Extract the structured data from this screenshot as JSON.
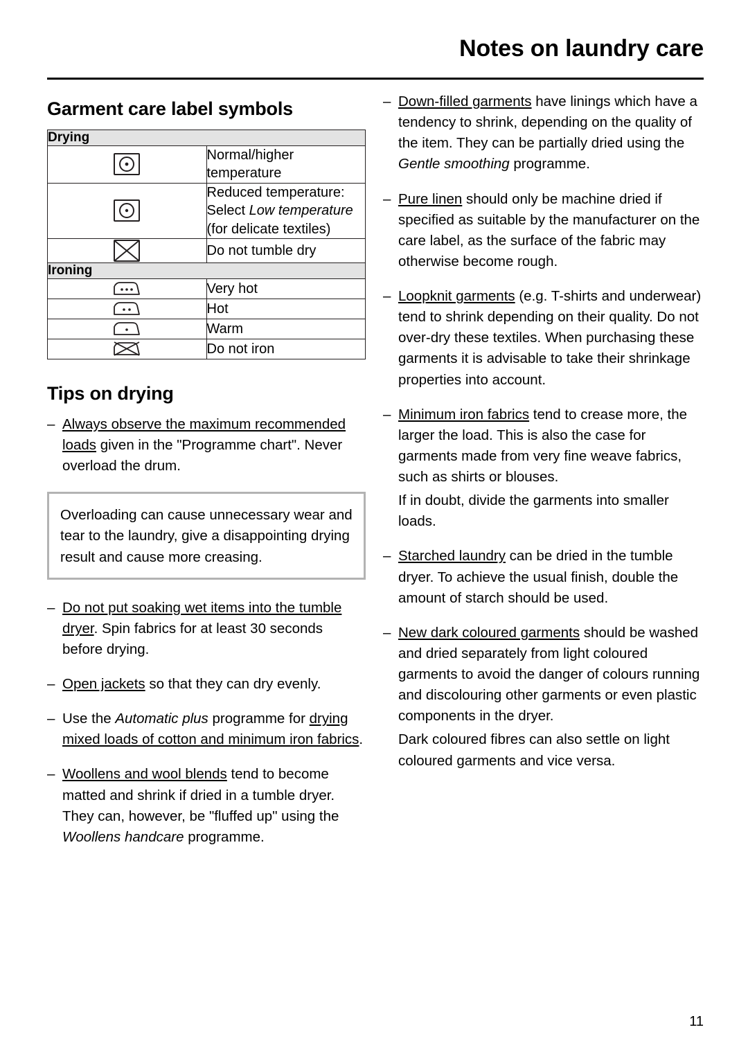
{
  "header": {
    "title": "Notes on laundry care"
  },
  "left": {
    "section_title": "Garment care label symbols",
    "table": {
      "groups": [
        {
          "heading": "Drying",
          "rows": [
            {
              "icon": "tumble-dry-normal-icon",
              "text": "Normal/higher temperature"
            },
            {
              "icon": "tumble-dry-reduced-icon",
              "text_line1": "Reduced temperature:",
              "text_line2_pre": "Select ",
              "text_line2_italic": "Low temperature",
              "text_line3": "(for delicate textiles)"
            },
            {
              "icon": "do-not-tumble-dry-icon",
              "text": "Do not tumble dry"
            }
          ]
        },
        {
          "heading": "Ironing",
          "rows": [
            {
              "icon": "iron-three-dots-icon",
              "text": "Very hot"
            },
            {
              "icon": "iron-two-dots-icon",
              "text": "Hot"
            },
            {
              "icon": "iron-one-dot-icon",
              "text": "Warm"
            },
            {
              "icon": "do-not-iron-icon",
              "text": "Do not iron"
            }
          ]
        }
      ]
    },
    "tips_title": "Tips on drying",
    "tips": [
      {
        "dash": "–",
        "underline": "Always observe the maximum recommended loads",
        "rest": " given in the \"Programme chart\". Never overload the drum."
      }
    ],
    "notebox": "Overloading can cause unnecessary wear and tear to the laundry, give a disappointing drying result and cause more creasing.",
    "tips2": [
      {
        "dash": "–",
        "underline": "Do not put soaking wet items into the tumble dryer",
        "rest": ". Spin fabrics for at least 30 seconds before drying."
      },
      {
        "dash": "–",
        "underline": "Open jackets",
        "rest": " so that they can dry evenly."
      }
    ],
    "tip_automatic": {
      "dash": "–",
      "pre": "Use the ",
      "italic": "Automatic plus",
      "mid": " programme for ",
      "underline": "drying mixed loads of cotton and minimum iron fabrics",
      "post": "."
    },
    "tip_woollens": {
      "dash": "–",
      "underline": "Woollens and wool blends",
      "mid": " tend to become matted and shrink if dried in a tumble dryer. They can, however, be \"fluffed up\" using the ",
      "italic": "Woollens handcare",
      "post": " programme."
    }
  },
  "right": {
    "items": [
      {
        "dash": "–",
        "underline": "Down-filled garments",
        "mid": " have linings which have a tendency to shrink, depending on the quality of the item. They can be partially dried using the ",
        "italic": "Gentle smoothing",
        "post": " programme."
      },
      {
        "dash": "–",
        "underline": "Pure linen",
        "mid": " should only be machine dried if specified as suitable by the manufacturer on the care label, as the surface of the fabric may otherwise become rough.",
        "italic": "",
        "post": ""
      },
      {
        "dash": "–",
        "underline": "Loopknit garments",
        "mid": " (e.g. T-shirts and underwear) tend to shrink depending on their quality. Do not over-dry these textiles. When purchasing these garments it is advisable to take their shrinkage properties into account.",
        "italic": "",
        "post": ""
      },
      {
        "dash": "–",
        "underline": "Minimum iron fabrics",
        "mid": " tend to crease more, the larger the load. This is also the case for garments made from very fine weave fabrics, such as shirts or blouses.",
        "italic": "",
        "post": ""
      },
      {
        "dash": "",
        "underline": "",
        "mid": "If in doubt, divide the garments into smaller loads.",
        "italic": "",
        "post": ""
      },
      {
        "dash": "–",
        "underline": "Starched laundry",
        "mid": " can be dried in the tumble dryer. To achieve the usual finish, double the amount of starch should be used.",
        "italic": "",
        "post": ""
      },
      {
        "dash": "–",
        "underline": "New dark coloured garments",
        "mid": " should be washed and dried separately from light coloured garments to avoid the danger of colours running and discolouring other garments or even plastic components in the dryer.",
        "italic": "",
        "post": ""
      },
      {
        "dash": "",
        "underline": "",
        "mid": "Dark coloured fibres can also settle on light coloured garments and vice versa.",
        "italic": "",
        "post": ""
      }
    ]
  },
  "footer": {
    "page_number": "11"
  }
}
